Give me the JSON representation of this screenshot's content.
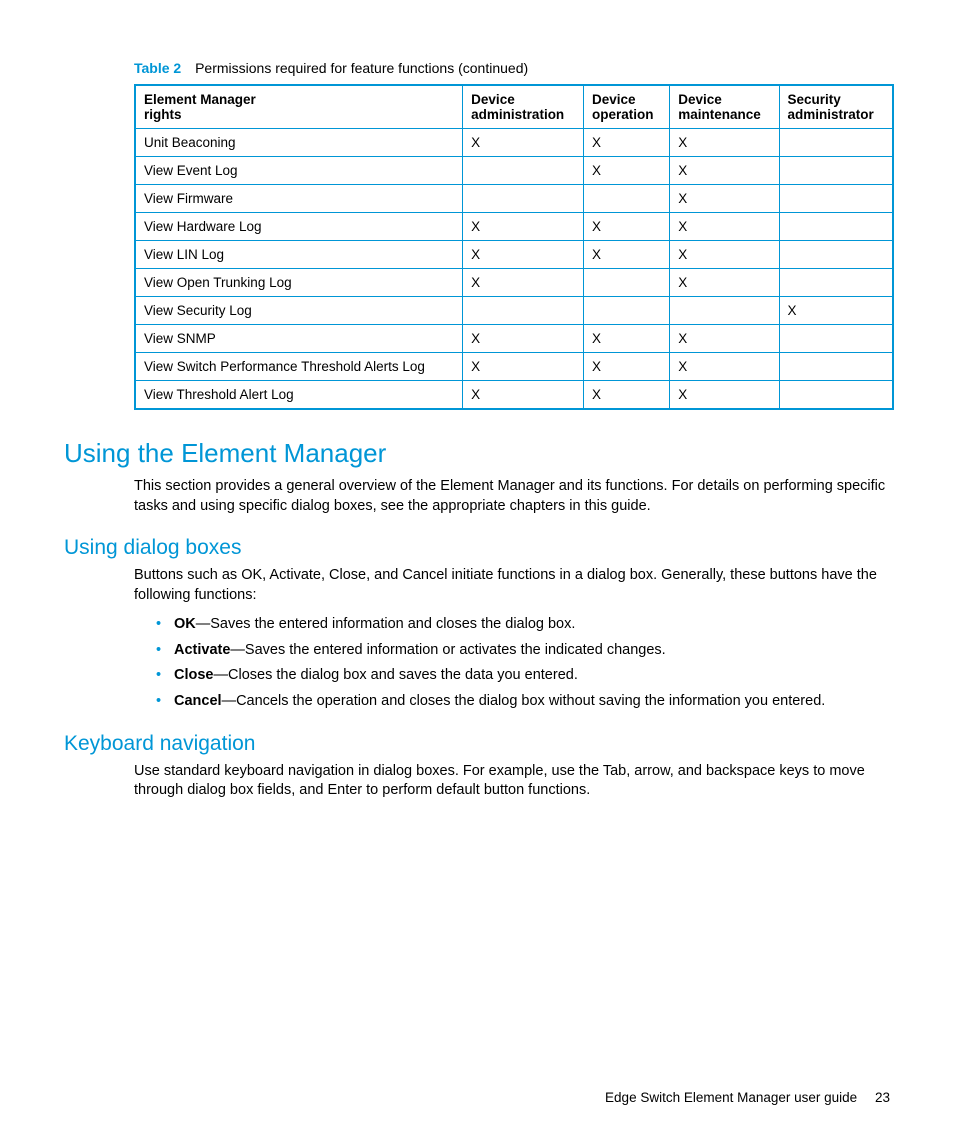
{
  "table": {
    "label": "Table 2",
    "caption": "Permissions required for feature functions (continued)",
    "columns": [
      {
        "line1": "Element Manager",
        "line2": "rights"
      },
      {
        "line1": "Device",
        "line2": "administration"
      },
      {
        "line1": "Device",
        "line2": "operation"
      },
      {
        "line1": "Device",
        "line2": "maintenance"
      },
      {
        "line1": "Security",
        "line2": "administrator"
      }
    ],
    "rows": [
      {
        "name": "Unit Beaconing",
        "cells": [
          "X",
          "X",
          "X",
          ""
        ]
      },
      {
        "name": "View Event Log",
        "cells": [
          "",
          "X",
          "X",
          ""
        ]
      },
      {
        "name": "View Firmware",
        "cells": [
          "",
          "",
          "X",
          ""
        ]
      },
      {
        "name": "View Hardware Log",
        "cells": [
          "X",
          "X",
          "X",
          ""
        ]
      },
      {
        "name": "View LIN Log",
        "cells": [
          "X",
          "X",
          "X",
          ""
        ]
      },
      {
        "name": "View Open Trunking Log",
        "cells": [
          "X",
          "",
          "X",
          ""
        ]
      },
      {
        "name": "View Security Log",
        "cells": [
          "",
          "",
          "",
          "X"
        ]
      },
      {
        "name": "View SNMP",
        "cells": [
          "X",
          "X",
          "X",
          ""
        ]
      },
      {
        "name": "View Switch Performance Threshold Alerts Log",
        "cells": [
          "X",
          "X",
          "X",
          ""
        ]
      },
      {
        "name": "View Threshold Alert Log",
        "cells": [
          "X",
          "X",
          "X",
          ""
        ]
      }
    ]
  },
  "section1": {
    "title": "Using the Element Manager",
    "body": "This section provides a general overview of the Element Manager and its functions. For details on performing specific tasks and using specific dialog boxes, see the appropriate chapters in this guide."
  },
  "section2": {
    "title": "Using dialog boxes",
    "intro": "Buttons such as OK, Activate, Close, and Cancel initiate functions in a dialog box. Generally, these buttons have the following functions:",
    "items": [
      {
        "term": "OK",
        "desc": "—Saves the entered information and closes the dialog box."
      },
      {
        "term": "Activate",
        "desc": "—Saves the entered information or activates the indicated changes."
      },
      {
        "term": "Close",
        "desc": "—Closes the dialog box and saves the data you entered."
      },
      {
        "term": "Cancel",
        "desc": "—Cancels the operation and closes the dialog box without saving the information you entered."
      }
    ]
  },
  "section3": {
    "title": "Keyboard navigation",
    "body": "Use standard keyboard navigation in dialog boxes. For example, use the Tab, arrow, and backspace keys to move through dialog box fields, and Enter to perform default button functions."
  },
  "footer": {
    "text": "Edge Switch Element Manager user guide",
    "page": "23"
  }
}
